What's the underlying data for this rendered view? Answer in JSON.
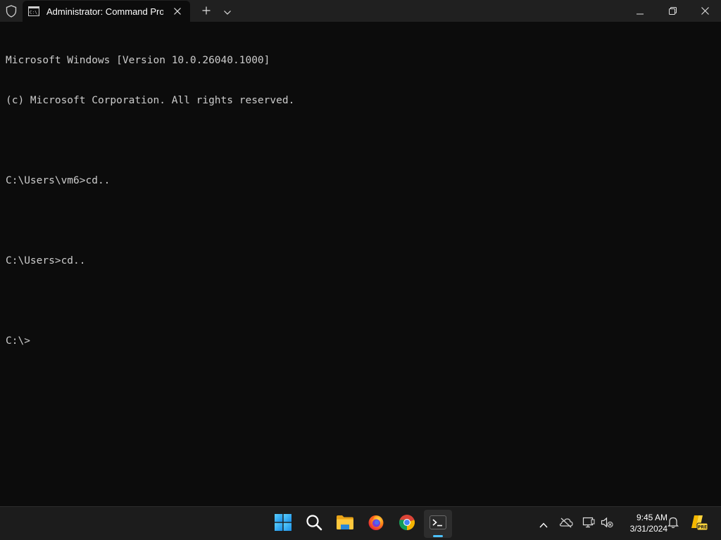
{
  "titlebar": {
    "tab_title": "Administrator: Command Pro",
    "icons": [
      "shield-icon",
      "cmd-icon",
      "close-icon",
      "plus-icon",
      "chevron-down-icon",
      "minimize-icon",
      "restore-icon",
      "close-window-icon"
    ]
  },
  "terminal": {
    "lines": [
      "Microsoft Windows [Version 10.0.26040.1000]",
      "(c) Microsoft Corporation. All rights reserved.",
      "",
      "C:\\Users\\vm6>cd..",
      "",
      "C:\\Users>cd..",
      "",
      "C:\\>"
    ]
  },
  "taskbar": {
    "apps": [
      "windows-start-icon",
      "search-icon",
      "file-explorer-icon",
      "firefox-icon",
      "chrome-icon",
      "terminal-icon"
    ],
    "tray": [
      "chevron-up-icon",
      "onedrive-offline-icon",
      "network-icon",
      "volume-muted-icon",
      "bell-icon",
      "copilot-pre-icon"
    ],
    "time": "9:45 AM",
    "date": "3/31/2024",
    "copilot_badge": "PRE"
  },
  "colors": {
    "terminal_bg": "#0c0c0c",
    "titlebar_bg": "#202020",
    "taskbar_bg": "#1c1c1c",
    "accent": "#4cc2ff",
    "text": "#cccccc"
  }
}
